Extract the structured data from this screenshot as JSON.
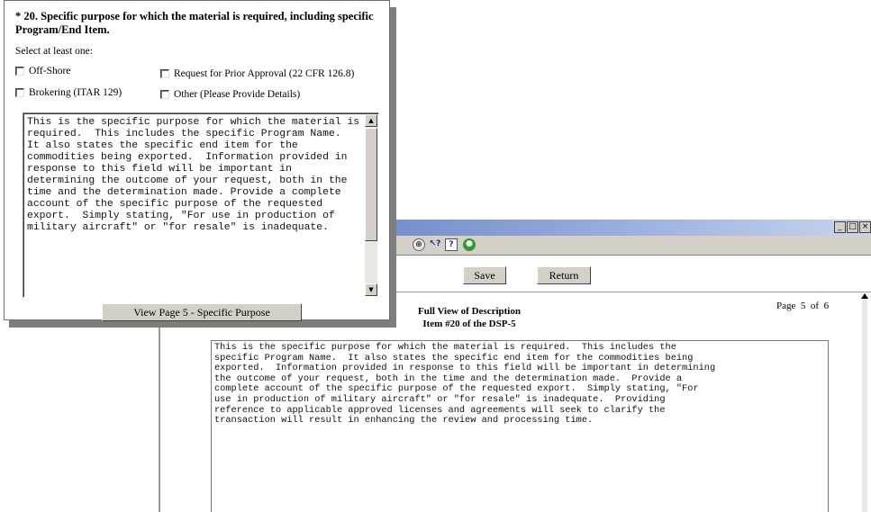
{
  "popup": {
    "heading": "* 20.  Specific purpose for which the material is required, including specific Program/End Item.",
    "select_hint": "Select at least one:",
    "checkboxes": [
      {
        "label": "Off-Shore",
        "checked": false
      },
      {
        "label": "Request for Prior Approval (22 CFR 126.8)",
        "checked": false
      },
      {
        "label": "Brokering (ITAR 129)",
        "checked": false
      },
      {
        "label": "Other (Please Provide Details)",
        "checked": false
      }
    ],
    "purpose_text": "This is the specific purpose for which the material is required.  This includes the specific Program Name.  It also states the specific end item for the commodities being exported.  Information provided in response to this field will be important in determining the outcome of your request, both in the time and the determination made. Provide a complete account of the specific purpose of the requested export.  Simply stating, \"For use in production of military aircraft\" or \"for resale\" is inadequate.",
    "view_page_button": "View Page 5 - Specific Purpose"
  },
  "full_view": {
    "window_controls": [
      "_",
      "□",
      "×"
    ],
    "buttons": {
      "save": "Save",
      "return": "Return"
    },
    "title_line1": "Full View of  Description",
    "title_line2": "Item #20 of the DSP-5",
    "page_label": "Page",
    "page_current": "5",
    "page_of": "of",
    "page_total": "6",
    "text": "This is the specific purpose for which the material is required.  This includes the\nspecific Program Name.  It also states the specific end item for the commodities being\nexported.  Information provided in response to this field will be important in determining\nthe outcome of your request, both in the time and the determination made.  Provide a\ncomplete account of the specific purpose of the requested export.  Simply stating, \"For\nuse in production of military aircraft\" or \"for resale\" is inadequate.  Providing\nreference to applicable approved licenses and agreements will seek to clarify the\ntransaction will result in enhancing the review and processing time."
  },
  "colors": {
    "titlebar": "#5570b8",
    "button_face": "#d4d0c8",
    "popup_shadow": "#7d7d7d"
  }
}
